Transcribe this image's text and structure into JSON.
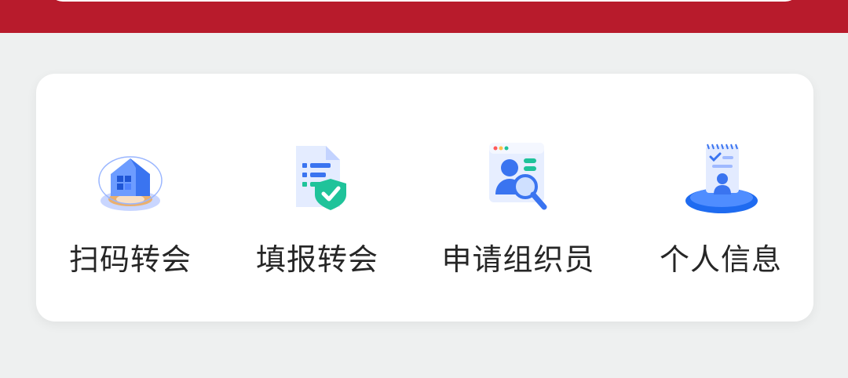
{
  "colors": {
    "banner": "#b81b2c",
    "page_background": "#eef0f0",
    "card_background": "#ffffff",
    "label_text": "#262626",
    "icon_blue": "#3a74f0",
    "icon_green": "#1fc39a"
  },
  "menu": {
    "items": [
      {
        "label": "扫码转会",
        "icon": "qr-scan-house-icon"
      },
      {
        "label": "填报转会",
        "icon": "document-shield-check-icon"
      },
      {
        "label": "申请组织员",
        "icon": "profile-search-icon"
      },
      {
        "label": "个人信息",
        "icon": "personal-info-notebook-icon"
      }
    ]
  }
}
